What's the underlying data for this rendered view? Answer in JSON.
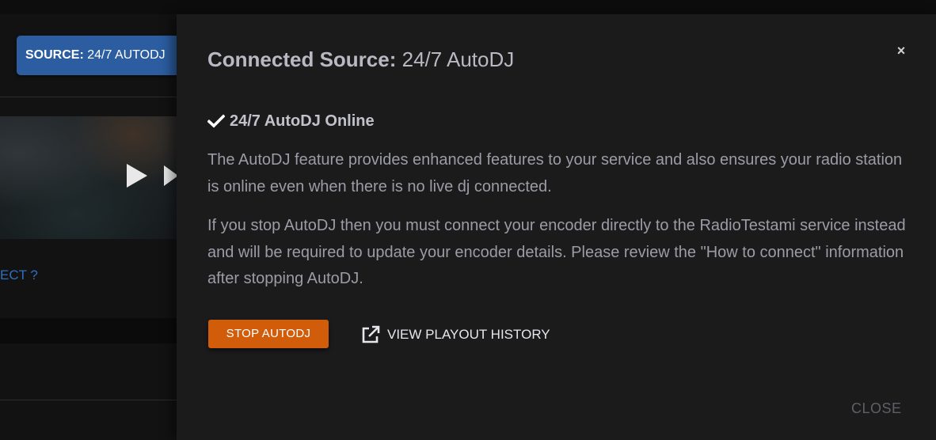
{
  "background": {
    "source_button": {
      "label_key": "SOURCE:",
      "label_value": "24/7 AUTODJ"
    },
    "connect_link": "ECT ?",
    "player": {
      "play_icon": "play-icon",
      "next_icon": "skip-next-icon"
    }
  },
  "modal": {
    "title_key": "Connected Source:",
    "title_value": "24/7 AutoDJ",
    "close_icon_glyph": "×",
    "status": {
      "icon": "check-icon",
      "text": "24/7 AutoDJ Online"
    },
    "paragraph_1": "The AutoDJ feature provides enhanced features to your service and also ensures your radio station is online even when there is no live dj connected.",
    "paragraph_2": "If you stop AutoDJ then you must connect your encoder directly to the RadioTestami service instead and will be required to update your encoder details. Please review the \"How to connect\" information after stopping AutoDJ.",
    "stop_button": "STOP AUTODJ",
    "history_link": {
      "icon": "external-link-icon",
      "label": "VIEW PLAYOUT HISTORY"
    },
    "close_button": "CLOSE"
  },
  "colors": {
    "accent_orange": "#d15d0b",
    "source_blue": "#2b5da0",
    "link_blue": "#2f6fbf",
    "modal_bg": "#1b1b1c"
  }
}
